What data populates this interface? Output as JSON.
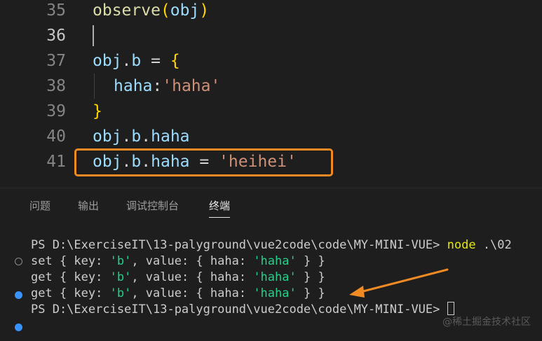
{
  "editor": {
    "lines": [
      {
        "num": "35",
        "tokens": {
          "a": "observe",
          "b": "(",
          "c": "obj",
          "d": ")"
        }
      },
      {
        "num": "36"
      },
      {
        "num": "37",
        "tokens": {
          "a": "obj",
          "b": ".",
          "c": "b",
          "d": " = ",
          "e": "{"
        }
      },
      {
        "num": "38",
        "tokens": {
          "a": "haha",
          "b": ":",
          "c": "'haha'"
        }
      },
      {
        "num": "39",
        "tokens": {
          "a": "}"
        }
      },
      {
        "num": "40",
        "tokens": {
          "a": "obj",
          "b": ".",
          "c": "b",
          "d": ".",
          "e": "haha"
        }
      },
      {
        "num": "41",
        "tokens": {
          "a": "obj",
          "b": ".",
          "c": "b",
          "d": ".",
          "e": "haha",
          "f": " = ",
          "g": "'heihei'"
        }
      }
    ]
  },
  "panel": {
    "tabs": [
      "问题",
      "输出",
      "调试控制台",
      "终端"
    ],
    "active_tab": "终端"
  },
  "terminal": {
    "line1": "PS D:\\ExerciseIT\\13-palyground\\vue2code\\code\\MY-MINI-VUE> ",
    "line1_cmd": "node",
    "line1_arg": " .\\02",
    "line2": {
      "a": "set { key: ",
      "b": "'b'",
      "c": ", value: { haha: ",
      "d": "'haha'",
      "e": " } }"
    },
    "line3": {
      "a": "get { key: ",
      "b": "'b'",
      "c": ", value: { haha: ",
      "d": "'haha'",
      "e": " } }"
    },
    "line4": {
      "a": "get { key: ",
      "b": "'b'",
      "c": ", value: { haha: ",
      "d": "'haha'",
      "e": " } }"
    },
    "line5": "PS D:\\ExerciseIT\\13-palyground\\vue2code\\code\\MY-MINI-VUE> "
  },
  "watermark": "@稀土掘金技术社区",
  "colors": {
    "highlight_box": "#f08a24",
    "arrow": "#f08a24"
  }
}
